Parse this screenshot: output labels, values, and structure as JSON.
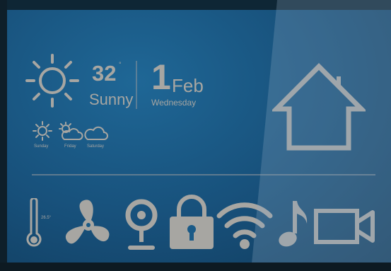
{
  "weather": {
    "temperature": "32",
    "degree_mark": "°",
    "condition": "Sunny",
    "forecast": [
      {
        "label": "Sunday",
        "icon": "sun-icon"
      },
      {
        "label": "Friday",
        "icon": "sun-cloud-icon"
      },
      {
        "label": "Saturday",
        "icon": "cloud-icon"
      }
    ]
  },
  "date": {
    "day": "1",
    "month": "Feb",
    "weekday": "Wednesday"
  },
  "controls": [
    {
      "name": "thermometer-icon",
      "label": "26.5°"
    },
    {
      "name": "fan-icon"
    },
    {
      "name": "webcam-icon"
    },
    {
      "name": "lock-icon"
    },
    {
      "name": "wifi-icon"
    },
    {
      "name": "music-note-icon"
    },
    {
      "name": "video-camera-icon"
    }
  ],
  "home_icon": "home-icon",
  "colors": {
    "panel_blue": "#1a5a87",
    "icon_gray": "#a7a6a2"
  }
}
